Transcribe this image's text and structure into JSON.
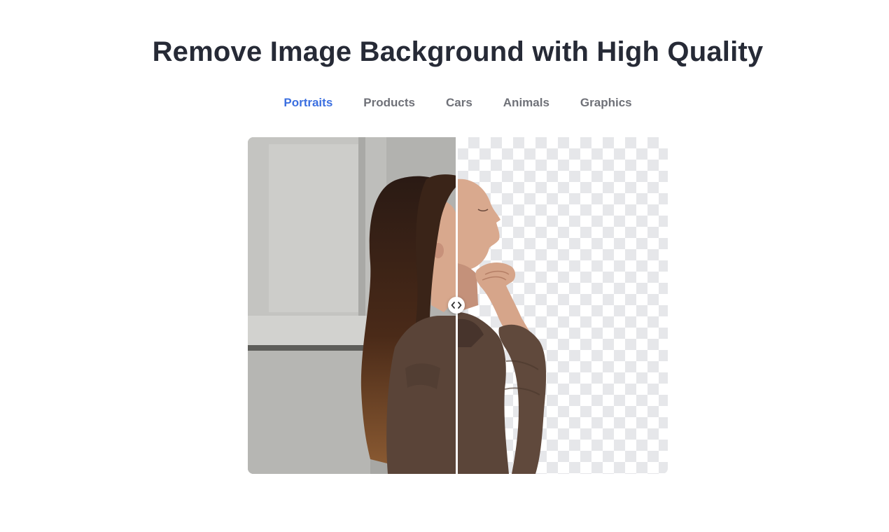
{
  "header": {
    "title": "Remove Image Background with High Quality"
  },
  "tabs": [
    {
      "label": "Portraits",
      "active": true
    },
    {
      "label": "Products",
      "active": false
    },
    {
      "label": "Cars",
      "active": false
    },
    {
      "label": "Animals",
      "active": false
    },
    {
      "label": "Graphics",
      "active": false
    }
  ],
  "compare": {
    "handle_icon": "chevron-left-right-icon"
  },
  "colors": {
    "accent": "#3b6fe0",
    "title": "#262a36",
    "tab_inactive": "#6f7178",
    "checker": "#e6e7ea"
  }
}
